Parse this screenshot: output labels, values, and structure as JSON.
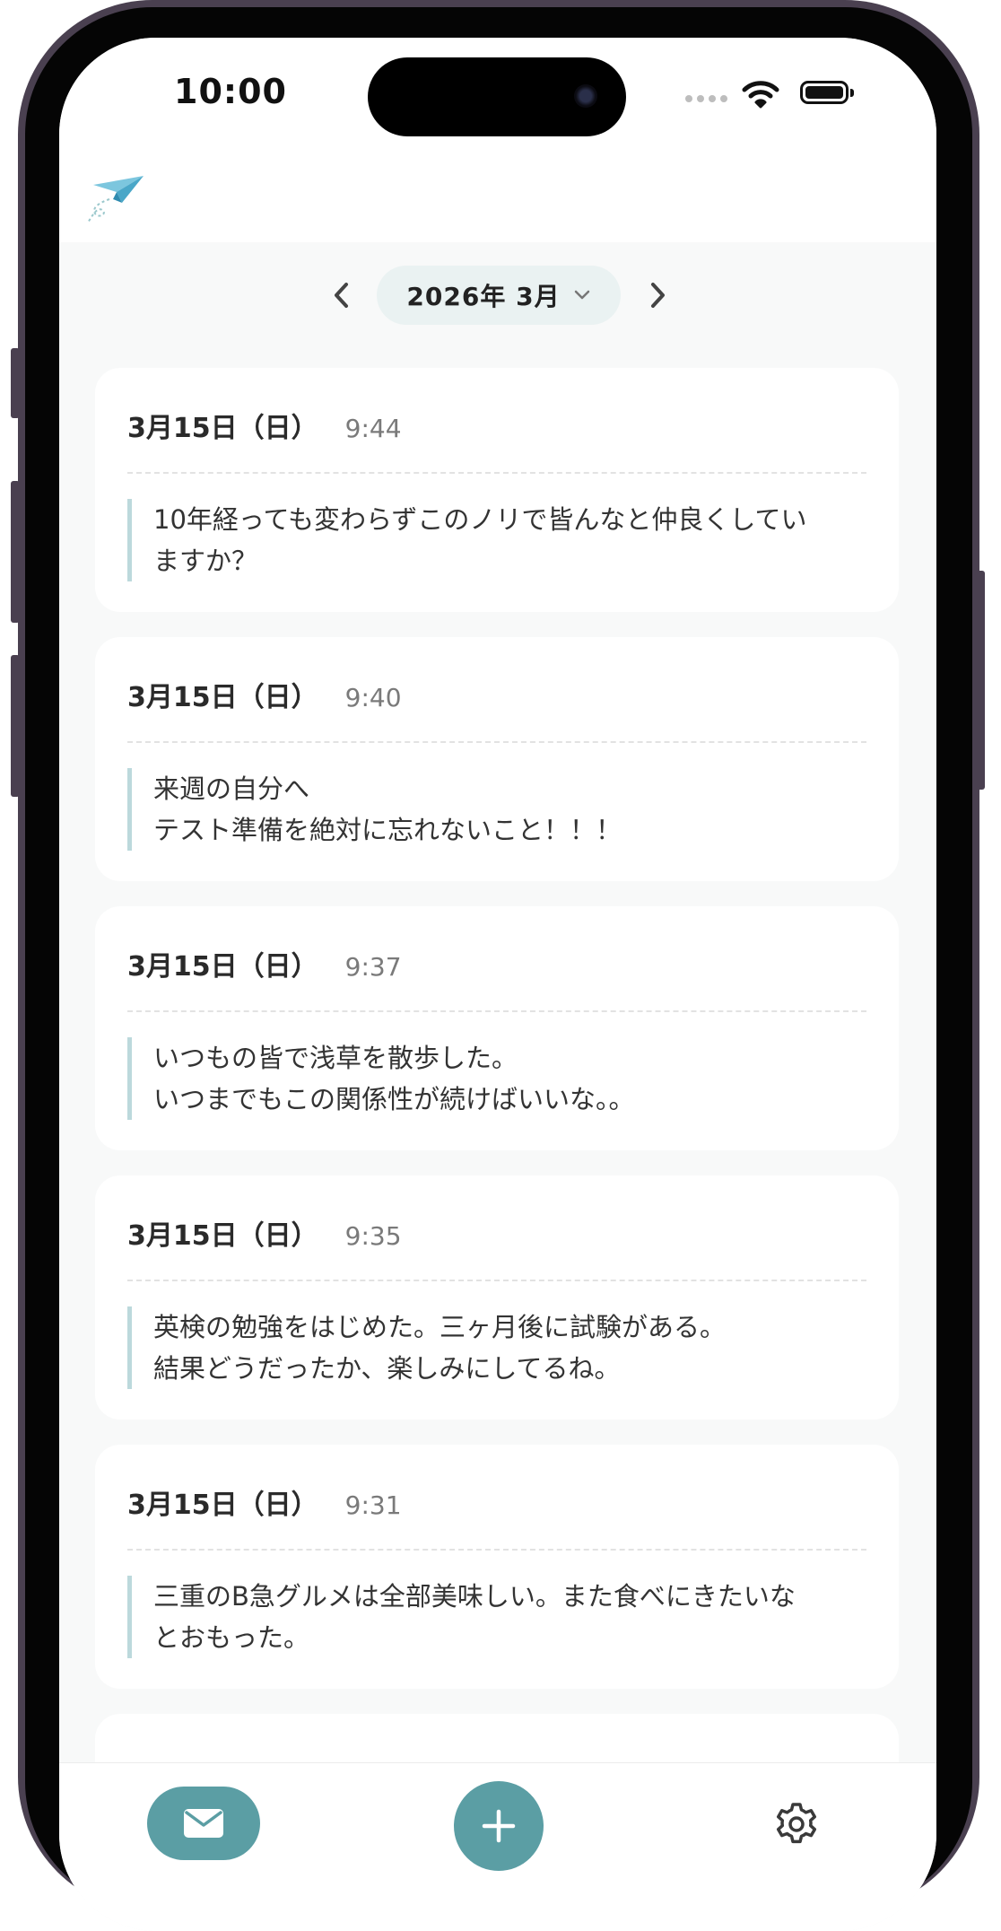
{
  "status_bar": {
    "time": "10:00"
  },
  "month_nav": {
    "label": "2026年 3月"
  },
  "entries": [
    {
      "date": "3月15日（日）",
      "time": "9:44",
      "lines": [
        "10年経っても変わらずこのノリで皆んなと仲良くしてい",
        "ますか？"
      ]
    },
    {
      "date": "3月15日（日）",
      "time": "9:40",
      "lines": [
        "来週の自分へ",
        "テスト準備を絶対に忘れないこと！！！"
      ]
    },
    {
      "date": "3月15日（日）",
      "time": "9:37",
      "lines": [
        "いつもの皆で浅草を散歩した。",
        "いつまでもこの関係性が続けばいいな。。"
      ]
    },
    {
      "date": "3月15日（日）",
      "time": "9:35",
      "lines": [
        "英検の勉強をはじめた。三ヶ月後に試験がある。",
        "結果どうだったか、楽しみにしてるね。"
      ]
    },
    {
      "date": "3月15日（日）",
      "time": "9:31",
      "lines": [
        "三重のB急グルメは全部美味しい。また食べにきたいな",
        "とおもった。"
      ]
    }
  ],
  "colors": {
    "accent": "#5b9ea4",
    "pill_bg": "#eaf2f2",
    "quote_bar": "#bcd9dc",
    "screen_bg": "#f8f9f9"
  },
  "icons": {
    "logo": "paper-plane-icon",
    "prev": "chevron-left-icon",
    "next": "chevron-right-icon",
    "dropdown": "chevron-down-icon",
    "mail": "envelope-icon",
    "add": "plus-icon",
    "settings": "gear-icon"
  }
}
